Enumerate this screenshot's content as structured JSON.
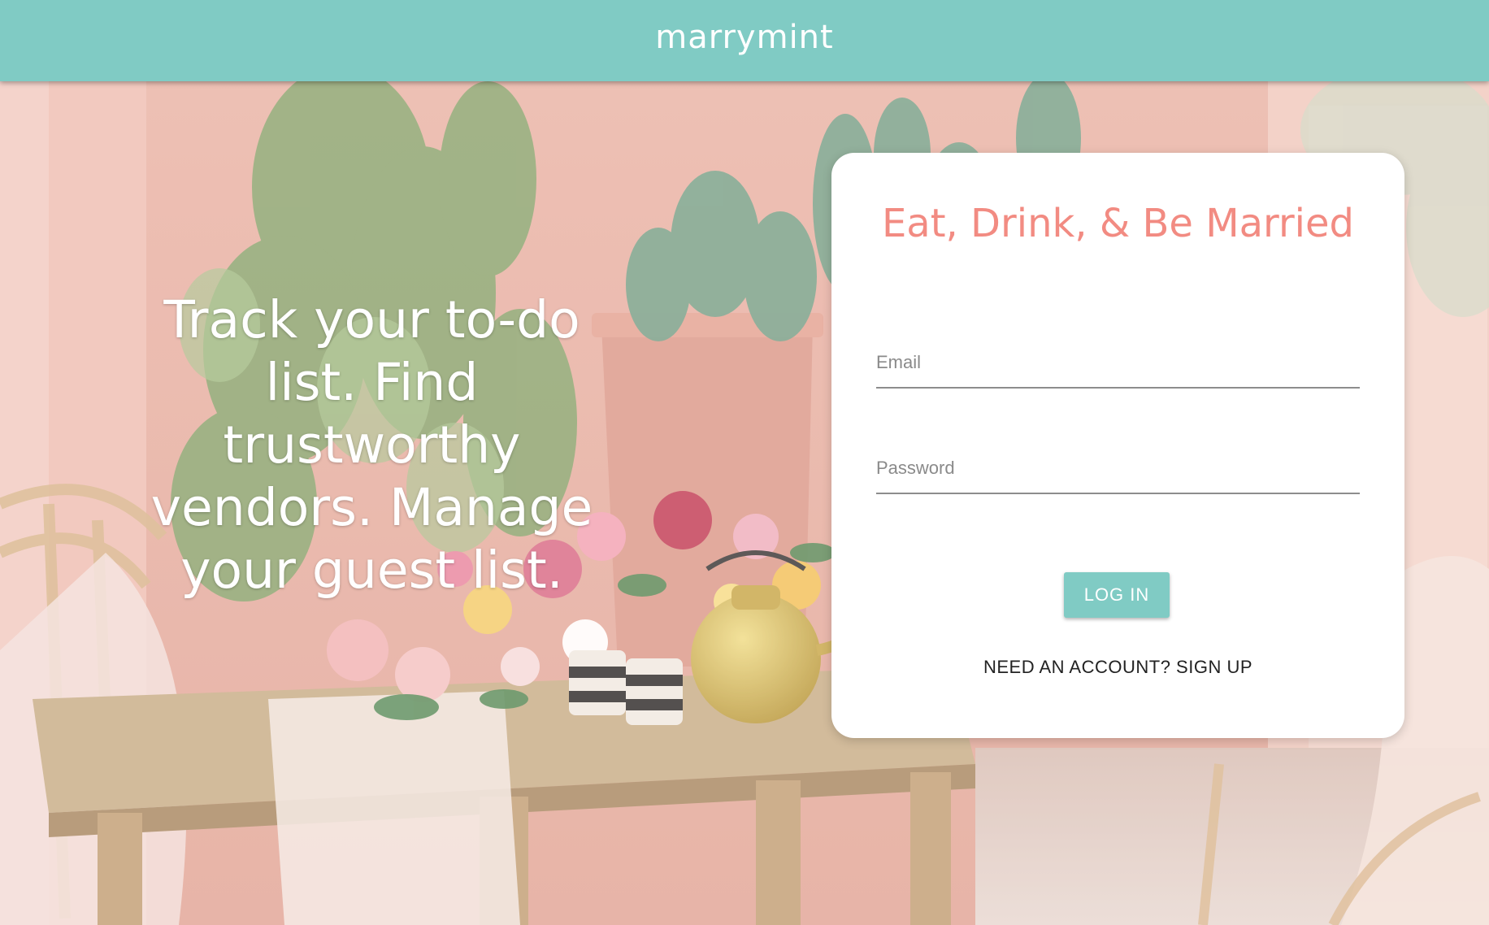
{
  "header": {
    "brand": "marrymint"
  },
  "hero": {
    "tagline": "Track your to-do list. Find trustworthy vendors. Manage your guest list."
  },
  "login_card": {
    "title": "Eat, Drink, & Be Married",
    "email_placeholder": "Email",
    "email_value": "",
    "password_placeholder": "Password",
    "password_value": "",
    "login_label": "LOG IN",
    "signup_label": "NEED AN ACCOUNT? SIGN UP"
  },
  "colors": {
    "header_bg": "#80CBC4",
    "title": "#F28B82",
    "button_bg": "#80CBC4"
  }
}
